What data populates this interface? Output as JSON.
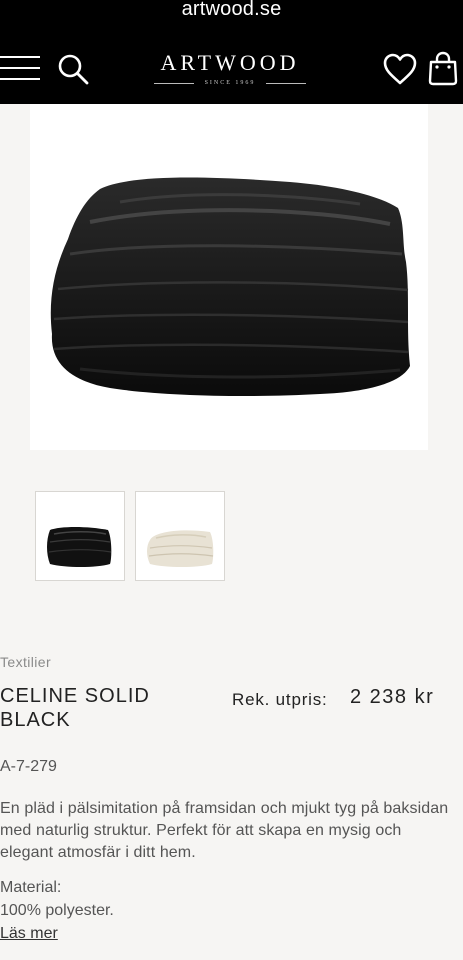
{
  "browser": {
    "url": "artwood.se"
  },
  "header": {
    "logo_text": "ARTWOOD",
    "logo_tagline": "SINCE 1969",
    "icons": [
      "menu-icon",
      "search-icon",
      "heart-icon",
      "bag-icon"
    ],
    "background": "#000000"
  },
  "gallery": {
    "main_image": "black faux fur throw",
    "thumbnails": [
      "black faux fur throw",
      "beige faux fur throw"
    ]
  },
  "product": {
    "category": "Textilier",
    "title": "CELINE SOLID BLACK",
    "price_label": "Rek. utpris:",
    "price": "2 238 kr",
    "sku": "A-7-279",
    "description": "En pläd i pälsimitation på framsidan och mjukt tyg på baksidan med naturlig struktur. Perfekt för att skapa en mysig och elegant atmosfär i ditt hem.",
    "material_label": "Material:",
    "material_value": "100% polyester.",
    "read_more": "Läs mer"
  },
  "colors": {
    "page_bg": "#f6f5f3",
    "text": "#555555",
    "header_bg": "#000000"
  }
}
